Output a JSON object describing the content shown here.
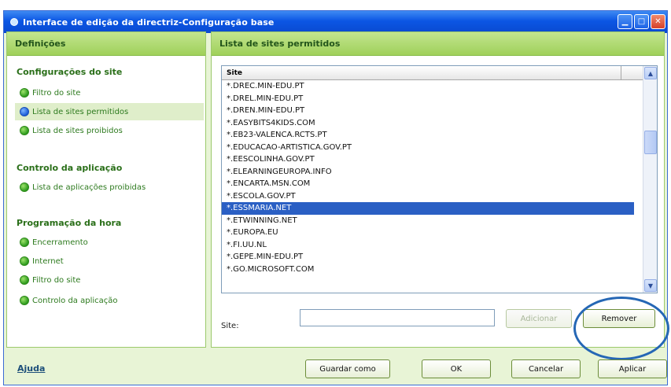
{
  "window": {
    "title": "Interface de edição da directriz-Configuração base",
    "buttons": {
      "minimize": "▁",
      "maximize": "□",
      "close": "✕"
    }
  },
  "left": {
    "header": "Definições",
    "sections": [
      {
        "title": "Configurações do site",
        "items": [
          {
            "label": "Filtro do site",
            "active": false
          },
          {
            "label": "Lista de sites permitidos",
            "active": true
          },
          {
            "label": "Lista de sites proibidos",
            "active": false
          }
        ]
      },
      {
        "title": "Controlo da aplicação",
        "items": [
          {
            "label": "Lista de aplicações proibidas",
            "active": false
          }
        ]
      },
      {
        "title": "Programação da hora",
        "items": [
          {
            "label": "Encerramento",
            "active": false
          },
          {
            "label": "Internet",
            "active": false
          },
          {
            "label": "Filtro do site",
            "active": false
          },
          {
            "label": "Controlo da aplicação",
            "active": false
          }
        ]
      }
    ]
  },
  "right": {
    "header": "Lista de sites permitidos",
    "list": {
      "column": "Site",
      "rows": [
        "*.DREC.MIN-EDU.PT",
        "*.DREL.MIN-EDU.PT",
        "*.DREN.MIN-EDU.PT",
        "*.EASYBITS4KIDS.COM",
        "*.EB23-VALENCA.RCTS.PT",
        "*.EDUCACAO-ARTISTICA.GOV.PT",
        "*.EESCOLINHA.GOV.PT",
        "*.ELEARNINGEUROPA.INFO",
        "*.ENCARTA.MSN.COM",
        "*.ESCOLA.GOV.PT",
        "*.ESSMARIA.NET",
        "*.ETWINNING.NET",
        "*.EUROPA.EU",
        "*.FI.UU.NL",
        "*.GEPE.MIN-EDU.PT",
        "*.GO.MICROSOFT.COM"
      ],
      "selected_row": "*.ESSMARIA.NET"
    },
    "site_label": "Site:",
    "site_value": "",
    "add_label": "Adicionar",
    "remove_label": "Remover"
  },
  "footer": {
    "help": "Ajuda",
    "save_as": "Guardar como",
    "ok": "OK",
    "cancel": "Cancelar",
    "apply": "Aplicar"
  },
  "colors": {
    "title_bar": "#0b56e4",
    "panel_header": "#9fd05a",
    "nav_text": "#2d7a1e",
    "selection": "#2a5fc4",
    "highlight_ring": "#2567b5"
  }
}
